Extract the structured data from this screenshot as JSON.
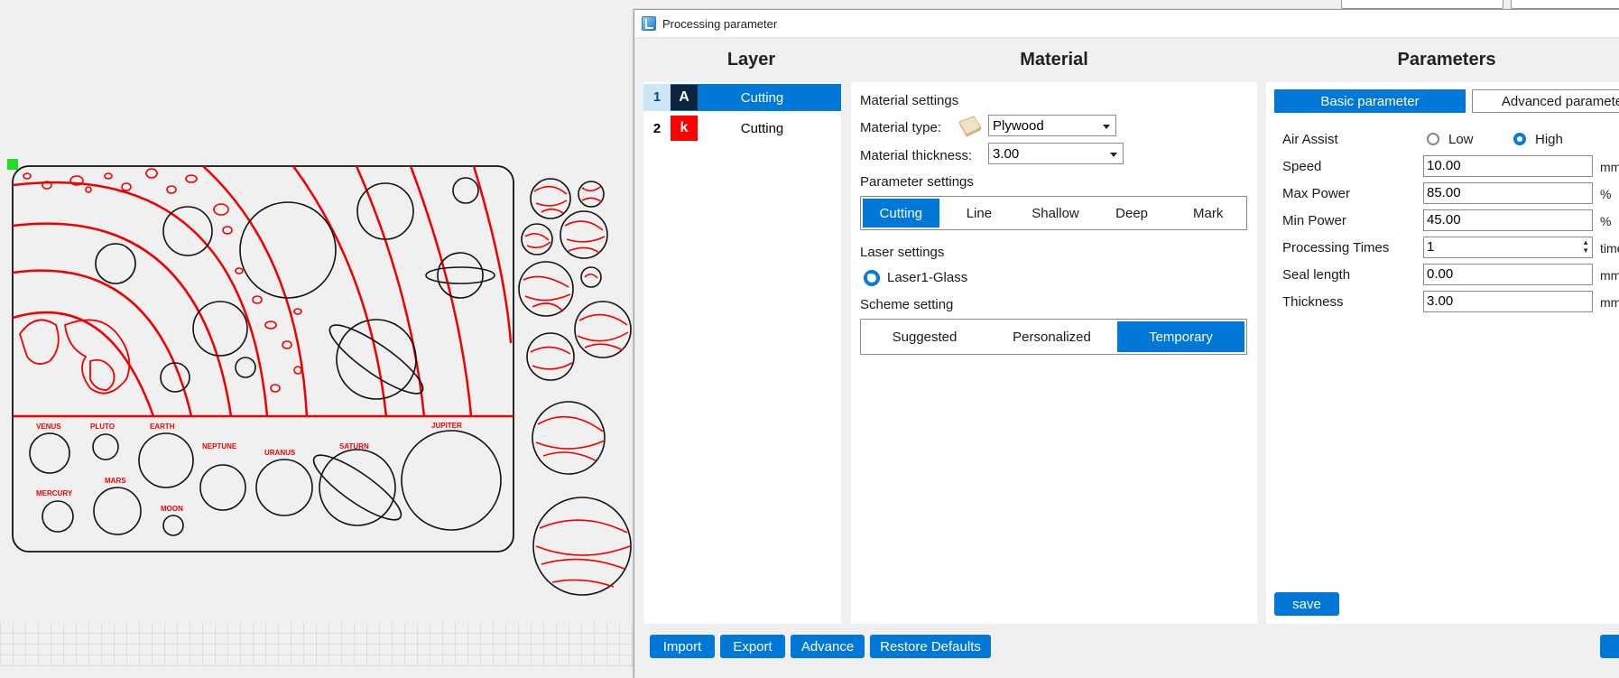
{
  "dialog": {
    "title": "Processing parameter",
    "columns": {
      "layer": "Layer",
      "material": "Material",
      "parameters": "Parameters"
    }
  },
  "layers": [
    {
      "num": "1",
      "chip": "A",
      "chip_color": "#0d2340",
      "mode": "Cutting",
      "selected": true
    },
    {
      "num": "2",
      "chip": "k",
      "chip_color": "#ff0000",
      "mode": "Cutting",
      "selected": false
    }
  ],
  "material": {
    "section_label": "Material settings",
    "type_label": "Material type:",
    "type_value": "Plywood",
    "thickness_label": "Material thickness:",
    "thickness_value": "3.00",
    "parameter_section": "Parameter settings",
    "modes": [
      "Cutting",
      "Line",
      "Shallow",
      "Deep",
      "Mark"
    ],
    "laser_section": "Laser settings",
    "laser_option": "Laser1-Glass",
    "scheme_section": "Scheme setting",
    "schemes": [
      "Suggested",
      "Personalized",
      "Temporary"
    ]
  },
  "parameters": {
    "tabs": [
      "Basic parameter",
      "Advanced paramete"
    ],
    "air_assist_label": "Air Assist",
    "air_low": "Low",
    "air_high": "High",
    "rows": [
      {
        "label": "Speed",
        "value": "10.00",
        "unit": "mm"
      },
      {
        "label": "Max Power",
        "value": "85.00",
        "unit": "%"
      },
      {
        "label": "Min Power",
        "value": "45.00",
        "unit": "%"
      },
      {
        "label": "Processing Times",
        "value": "1",
        "unit": "time"
      },
      {
        "label": "Seal length",
        "value": "0.00",
        "unit": "mm"
      },
      {
        "label": "Thickness",
        "value": "3.00",
        "unit": "mm"
      }
    ],
    "save_label": "save"
  },
  "footer": {
    "import": "Import",
    "export": "Export",
    "advance": "Advance",
    "restore": "Restore Defaults"
  },
  "design_labels": [
    "VENUS",
    "PLUTO",
    "EARTH",
    "NEPTUNE",
    "URANUS",
    "SATURN",
    "JUPITER",
    "MERCURY",
    "MARS",
    "MOON"
  ],
  "colors": {
    "accent": "#0078d7",
    "cut_line": "#ee0000"
  }
}
